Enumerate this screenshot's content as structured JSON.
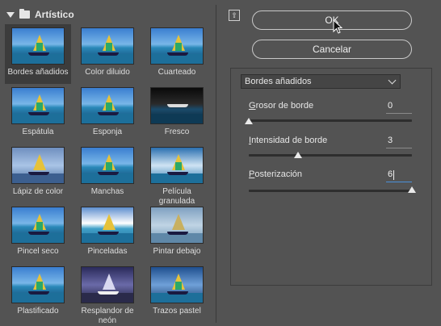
{
  "gallery": {
    "folder_name": "Artístico",
    "items": [
      {
        "label": "Bordes añadidos",
        "selected": true
      },
      {
        "label": "Color diluido"
      },
      {
        "label": "Cuarteado"
      },
      {
        "label": "Espátula"
      },
      {
        "label": "Esponja"
      },
      {
        "label": "Fresco"
      },
      {
        "label": "Lápiz de color"
      },
      {
        "label": "Manchas"
      },
      {
        "label": "Película granulada"
      },
      {
        "label": "Pincel seco"
      },
      {
        "label": "Pinceladas"
      },
      {
        "label": "Pintar debajo"
      },
      {
        "label": "Plastificado"
      },
      {
        "label": "Resplandor de neón"
      },
      {
        "label": "Trazos pastel"
      }
    ]
  },
  "buttons": {
    "ok": "OK",
    "cancel": "Cancelar"
  },
  "filter": {
    "selected": "Bordes añadidos"
  },
  "params": [
    {
      "label_initial": "G",
      "label_rest": "rosor de borde",
      "value": "0",
      "level_fraction": 0.0
    },
    {
      "label_initial": "I",
      "label_rest": "ntensidad de borde",
      "value": "3",
      "level_fraction": 0.3
    },
    {
      "label_initial": "P",
      "label_rest": "osterización",
      "value": "6",
      "level_fraction": 1.0
    }
  ],
  "colors": {
    "background": "#535353",
    "accent": "#4a90d9"
  }
}
